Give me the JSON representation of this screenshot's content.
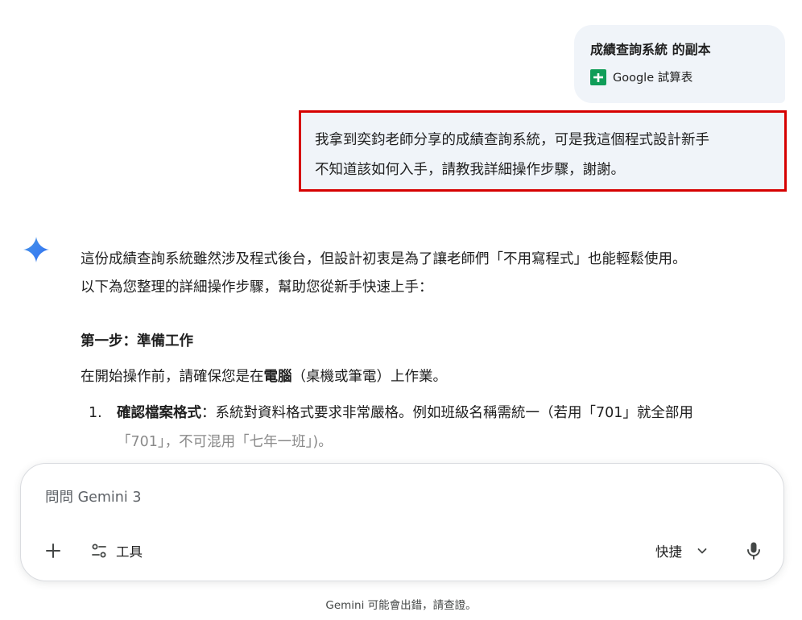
{
  "attachment": {
    "title": "成績查詢系統 的副本",
    "type_label": "Google 試算表",
    "icon": "google-sheets-icon",
    "icon_color": "#0f9d58"
  },
  "user_message": {
    "line1": "我拿到奕鈞老師分享的成績查詢系統，可是我這個程式設計新手",
    "line2": "不知道該如何入手，請教我詳細操作步驟，謝謝。",
    "highlight_color": "#d60000"
  },
  "response": {
    "avatar_icon": "gemini-spark-icon",
    "para_line1": "這份成績查詢系統雖然涉及程式後台，但設計初衷是為了讓老師們「不用寫程式」也能輕鬆使用。",
    "para_line2": "以下為您整理的詳細操作步驟，幫助您從新手快速上手：",
    "step_heading": "第一步：準備工作",
    "step_intro_pre": "在開始操作前，請確保您是在",
    "step_intro_bold": "電腦",
    "step_intro_post": "（桌機或筆電）上作業。",
    "list_number": "1.",
    "list_bold": "確認檔案格式",
    "list_text": "：系統對資料格式要求非常嚴格。例如班級名稱需統一（若用「701」就全部用",
    "list_text_faded": "「701」，不可混用「七年一班」)。"
  },
  "input": {
    "placeholder": "問問 Gemini 3",
    "plus_icon": "plus-icon",
    "tools_icon": "tools-icon",
    "tools_label": "工具",
    "mode_label": "快捷",
    "mode_icon": "chevron-down-icon",
    "mic_icon": "microphone-icon"
  },
  "footer": {
    "disclaimer": "Gemini 可能會出錯，請查證。"
  }
}
